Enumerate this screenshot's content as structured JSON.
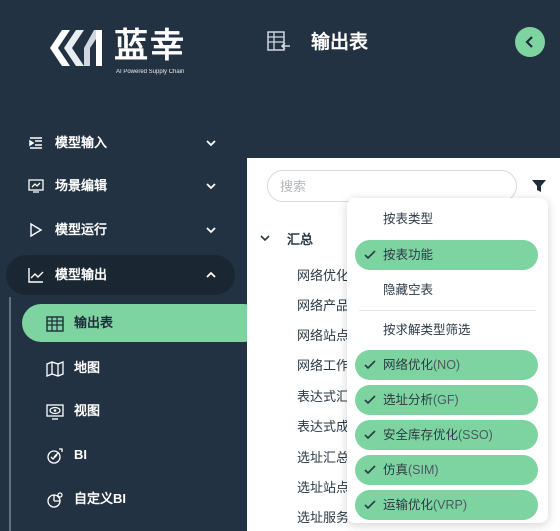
{
  "brand": {
    "name": "蓝幸",
    "tagline": "AI Powered Supply Chain"
  },
  "sidebar": {
    "items": [
      {
        "label": "模型输入",
        "icon": "indent-list-icon",
        "state": "collapsed"
      },
      {
        "label": "场景编辑",
        "icon": "chart-monitor-icon",
        "state": "collapsed"
      },
      {
        "label": "模型运行",
        "icon": "play-icon",
        "state": "collapsed"
      },
      {
        "label": "模型输出",
        "icon": "line-chart-icon",
        "state": "expanded"
      }
    ],
    "subitems": [
      {
        "label": "输出表",
        "icon": "table-icon",
        "active": true
      },
      {
        "label": "地图",
        "icon": "map-icon",
        "active": false
      },
      {
        "label": "视图",
        "icon": "eye-screen-icon",
        "active": false
      },
      {
        "label": "BI",
        "icon": "chart-check-icon",
        "active": false
      },
      {
        "label": "自定义BI",
        "icon": "custom-chart-icon",
        "active": false
      }
    ]
  },
  "header": {
    "title": "输出表",
    "back_icon": "chevron-left-icon"
  },
  "search": {
    "placeholder": "搜索"
  },
  "tree": {
    "group_label": "汇总",
    "items": [
      "网络优化",
      "网络产品",
      "网络站点",
      "网络工作",
      "表达式汇",
      "表达式成",
      "选址汇总",
      "选址站点",
      "选址服务"
    ]
  },
  "dropdown": {
    "items": [
      {
        "label": "按表类型",
        "selected": false
      },
      {
        "label": "按表功能",
        "selected": true
      },
      {
        "label": "隐藏空表",
        "selected": false
      }
    ],
    "section_label": "按求解类型筛选",
    "solver_items": [
      {
        "label": "网络优化",
        "suffix": "(NO)",
        "selected": true
      },
      {
        "label": "选址分析",
        "suffix": "(GF)",
        "selected": true
      },
      {
        "label": "安全库存优化",
        "suffix": "(SSO)",
        "selected": true
      },
      {
        "label": "仿真",
        "suffix": "(SIM)",
        "selected": true
      },
      {
        "label": "运输优化",
        "suffix": "(VRP)",
        "selected": true
      }
    ]
  },
  "colors": {
    "sidebar_bg": "#233242",
    "accent": "#7ed4a0",
    "text_dark": "#2b3945"
  }
}
